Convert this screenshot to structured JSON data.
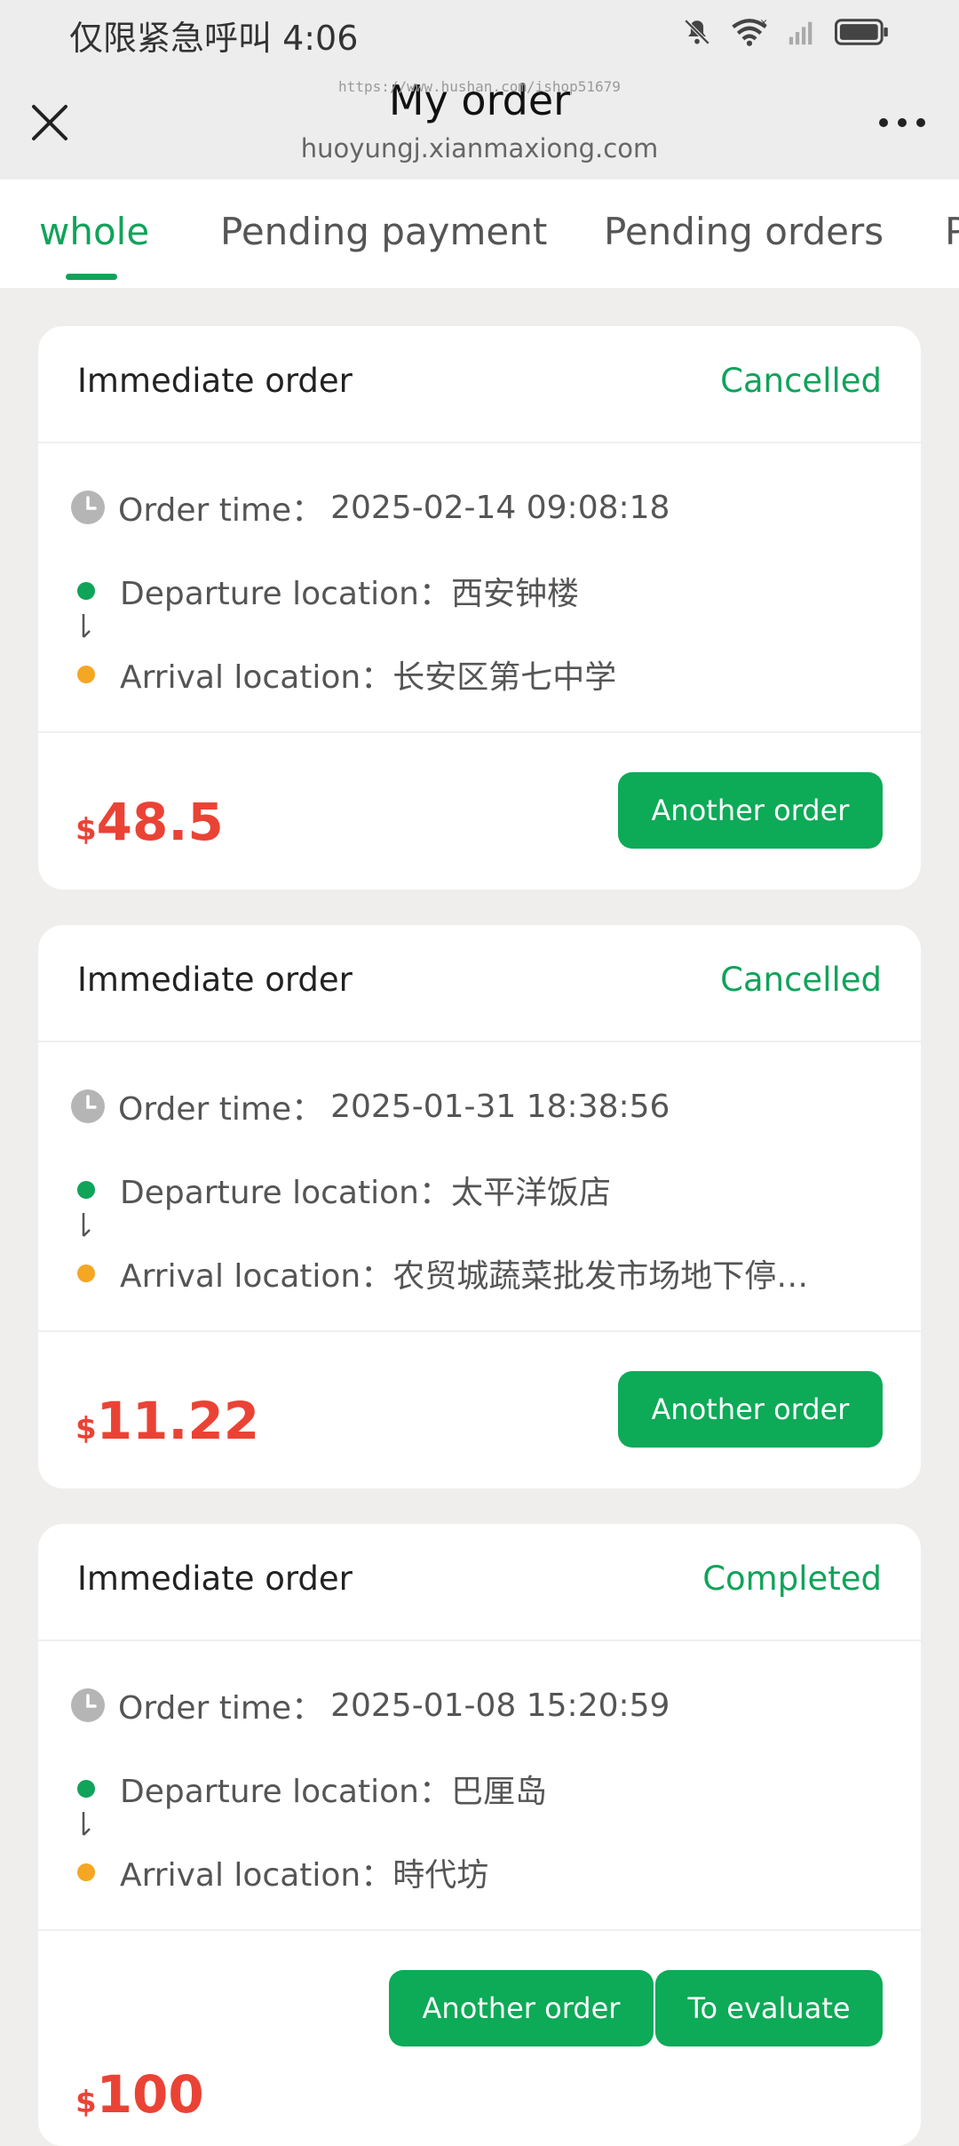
{
  "status_bar": {
    "text": "仅限紧急呼叫 4:06",
    "icons": [
      "bell-off-icon",
      "wifi-icon",
      "signal-icon",
      "battery-icon"
    ]
  },
  "header": {
    "title": "My order",
    "url": "huoyungj.xianmaxiong.com",
    "watermark": "https://www.hushan.com/ishop51679",
    "close_icon": "close-icon",
    "more_icon": "more-icon"
  },
  "tabs": [
    "whole",
    "Pending payment",
    "Pending orders",
    "P"
  ],
  "active_tab": 0,
  "colors": {
    "accent": "#10a35a",
    "price": "#ea4335",
    "departure_dot": "#10a35a",
    "arrival_dot": "#f5a623"
  },
  "labels": {
    "order_time": "Order time：",
    "departure": "Departure location：",
    "arrival": "Arrival location："
  },
  "orders": [
    {
      "type": "Immediate order",
      "status": "Cancelled",
      "time": "2025-02-14 09:08:18",
      "departure": "西安钟楼",
      "arrival": "长安区第七中学",
      "currency": "$",
      "price": "48.5",
      "buttons": [
        "Another order"
      ]
    },
    {
      "type": "Immediate order",
      "status": "Cancelled",
      "time": "2025-01-31 18:38:56",
      "departure": "太平洋饭店",
      "arrival": "农贸城蔬菜批发市场地下停…",
      "currency": "$",
      "price": "11.22",
      "buttons": [
        "Another order"
      ]
    },
    {
      "type": "Immediate order",
      "status": "Completed",
      "time": "2025-01-08 15:20:59",
      "departure": "巴厘岛",
      "arrival": "時代坊",
      "currency": "$",
      "price": "100",
      "buttons": [
        "Another order",
        "To evaluate"
      ]
    }
  ]
}
